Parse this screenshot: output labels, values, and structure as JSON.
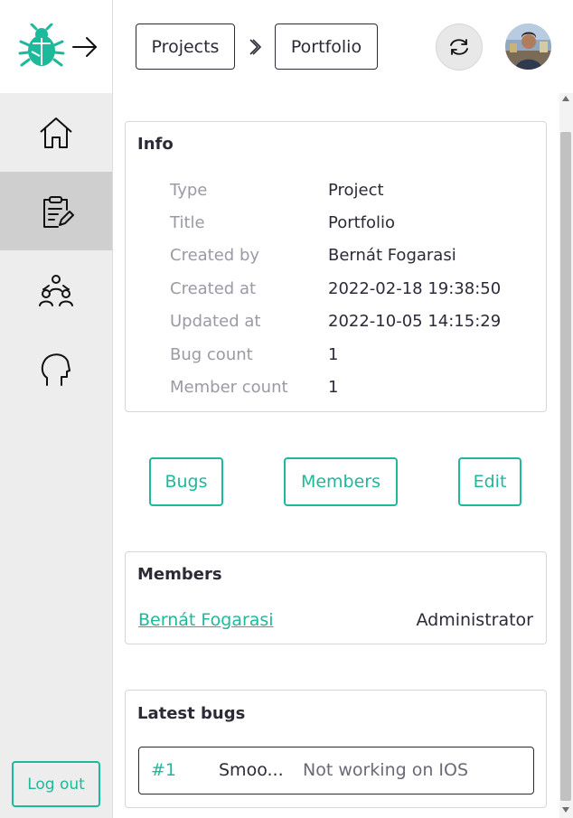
{
  "sidebar": {
    "logo_icon": "bug-logo-icon",
    "collapse_icon": "arrow-right-icon",
    "nav": [
      {
        "icon": "home-icon"
      },
      {
        "icon": "clipboard-edit-icon",
        "active": true
      },
      {
        "icon": "team-icon"
      },
      {
        "icon": "head-profile-icon"
      }
    ],
    "logout_label": "Log out"
  },
  "header": {
    "breadcrumbs": [
      "Projects",
      "Portfolio"
    ],
    "separator_icon": "chevron-right-icon",
    "refresh_icon": "refresh-icon",
    "avatar_icon": "user-avatar"
  },
  "info": {
    "title": "Info",
    "rows": [
      {
        "label": "Type",
        "value": "Project"
      },
      {
        "label": "Title",
        "value": "Portfolio"
      },
      {
        "label": "Created by",
        "value": "Bernát Fogarasi"
      },
      {
        "label": "Created at",
        "value": "2022-02-18 19:38:50"
      },
      {
        "label": "Updated at",
        "value": "2022-10-05 14:15:29"
      },
      {
        "label": "Bug count",
        "value": "1"
      },
      {
        "label": "Member count",
        "value": "1"
      }
    ]
  },
  "actions": {
    "bugs": "Bugs",
    "members": "Members",
    "edit": "Edit"
  },
  "members": {
    "title": "Members",
    "items": [
      {
        "name": "Bernát Fogarasi",
        "role": "Administrator"
      }
    ]
  },
  "latest_bugs": {
    "title": "Latest bugs",
    "items": [
      {
        "id": "#1",
        "short": "Smoo...",
        "title": "Not working on IOS"
      }
    ]
  },
  "colors": {
    "accent": "#1db99a",
    "text": "#2b2b38",
    "muted": "#9a9aa4",
    "sidebar_bg": "#ededed",
    "sidebar_active": "#cfcfcf"
  }
}
